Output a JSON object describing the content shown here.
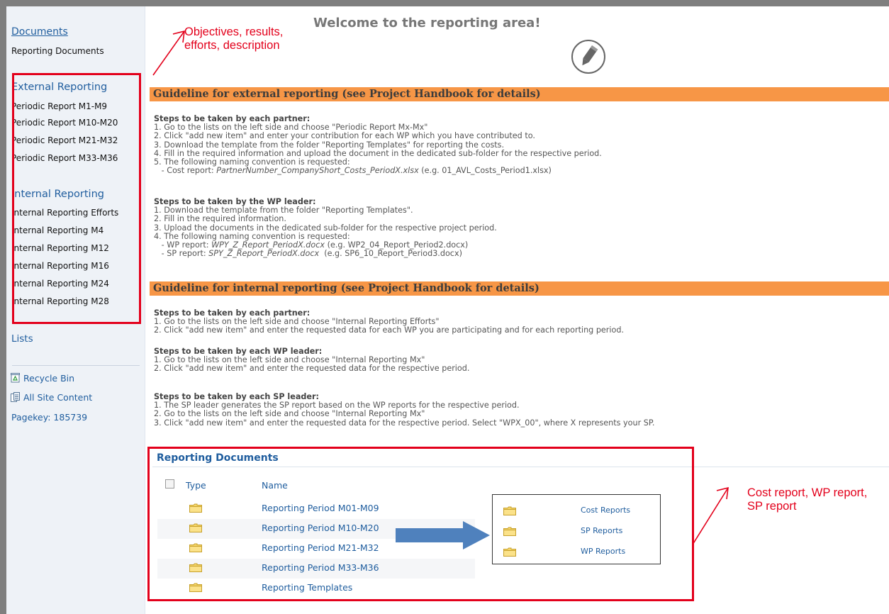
{
  "sidebar": {
    "documents_link": "Documents",
    "reporting_documents": "Reporting Documents",
    "external_heading": "External Reporting",
    "external_items": [
      "Periodic Report M1-M9",
      "Periodic Report M10-M20",
      "Periodic Report M21-M32",
      "Periodic Report M33-M36"
    ],
    "internal_heading": "Internal Reporting",
    "internal_items": [
      "Internal Reporting Efforts",
      "Internal Reporting M4",
      "Internal Reporting M12",
      "Internal Reporting M16",
      "Internal Reporting M24",
      "Internal Reporting M28"
    ],
    "lists": "Lists",
    "recycle_bin": "Recycle Bin",
    "all_site_content": "All Site Content",
    "pagekey": "Pagekey: 185739"
  },
  "annotations": {
    "top": "Objectives, results,\nefforts, description",
    "right": "Cost report, WP report,\nSP report"
  },
  "main": {
    "title": "Welcome to the reporting area!",
    "external_banner": "Guideline for external reporting (see Project Handbook for details)",
    "ext_partner_heading": "Steps to be taken by each partner:",
    "ext_partner_steps": [
      "1. Go to the lists on the left side and choose \"Periodic Report Mx-Mx\"",
      "2. Click \"add new item\" and enter your contribution for each WP which you have contributed to.",
      "3. Download the template from the folder \"Reporting Templates\" for reporting the costs.",
      "4. Fill in the required information and upload the document in the dedicated sub-folder for the respective period.",
      "5. The following naming convention is requested:"
    ],
    "ext_cost_prefix": "   - Cost report: ",
    "ext_cost_italic": "PartnerNumber_CompanyShort_Costs_PeriodX.xlsx",
    "ext_cost_suffix": " (e.g. 01_AVL_Costs_Period1.xlsx)",
    "ext_wp_heading": "Steps to be taken by the WP leader:",
    "ext_wp_steps": [
      "1. Download the template from the folder \"Reporting Templates\".",
      "2. Fill in the required information.",
      "3. Upload the documents in the dedicated sub-folder for the respective project period.",
      "4. The following naming convention is requested:"
    ],
    "ext_wpr_prefix": "   - WP report: ",
    "ext_wpr_italic": "WPY_Z_Report_PeriodX.docx",
    "ext_wpr_suffix": " (e.g. WP2_04_Report_Period2.docx)",
    "ext_spr_prefix": "   - SP report: ",
    "ext_spr_italic": "SPY_Z_Report_PeriodX.docx",
    "ext_spr_suffix": "  (e.g. SP6_10_Report_Period3.docx)",
    "internal_banner": "Guideline for internal reporting (see Project Handbook for details)",
    "int_partner_heading": "Steps to be taken by each partner:",
    "int_partner_steps": [
      "1. Go to the lists on the left side and choose \"Internal Reporting Efforts\"",
      "2. Click \"add new item\" and enter the requested data for each WP you are participating and for each reporting period."
    ],
    "int_wp_heading": "Steps to be taken by each WP leader:",
    "int_wp_steps": [
      "1. Go to the lists on the left side and choose \"Internal Reporting Mx\"",
      "2. Click \"add new item\" and enter the requested data for the respective period."
    ],
    "int_sp_heading": "Steps to be taken by each SP leader:",
    "int_sp_steps": [
      "1. The SP leader generates the SP report based on the WP reports for the respective period.",
      "2. Go to the lists on the left side and choose \"Internal Reporting Mx\"",
      "3. Click \"add new item\" and enter the requested data for the respective period. Select \"WPX_00\", where X represents your SP."
    ]
  },
  "library": {
    "title": "Reporting Documents",
    "col_type": "Type",
    "col_name": "Name",
    "rows": [
      "Reporting Period M01-M09",
      "Reporting Period M10-M20",
      "Reporting Period M21-M32",
      "Reporting Period M33-M36",
      "Reporting Templates"
    ],
    "subfolders": [
      "Cost Reports",
      "SP Reports",
      "WP Reports"
    ]
  },
  "colors": {
    "banner": "#f79646",
    "annotation_red": "#e3001b",
    "link_blue": "#1f5d9e",
    "arrow_blue": "#4f81bd"
  }
}
